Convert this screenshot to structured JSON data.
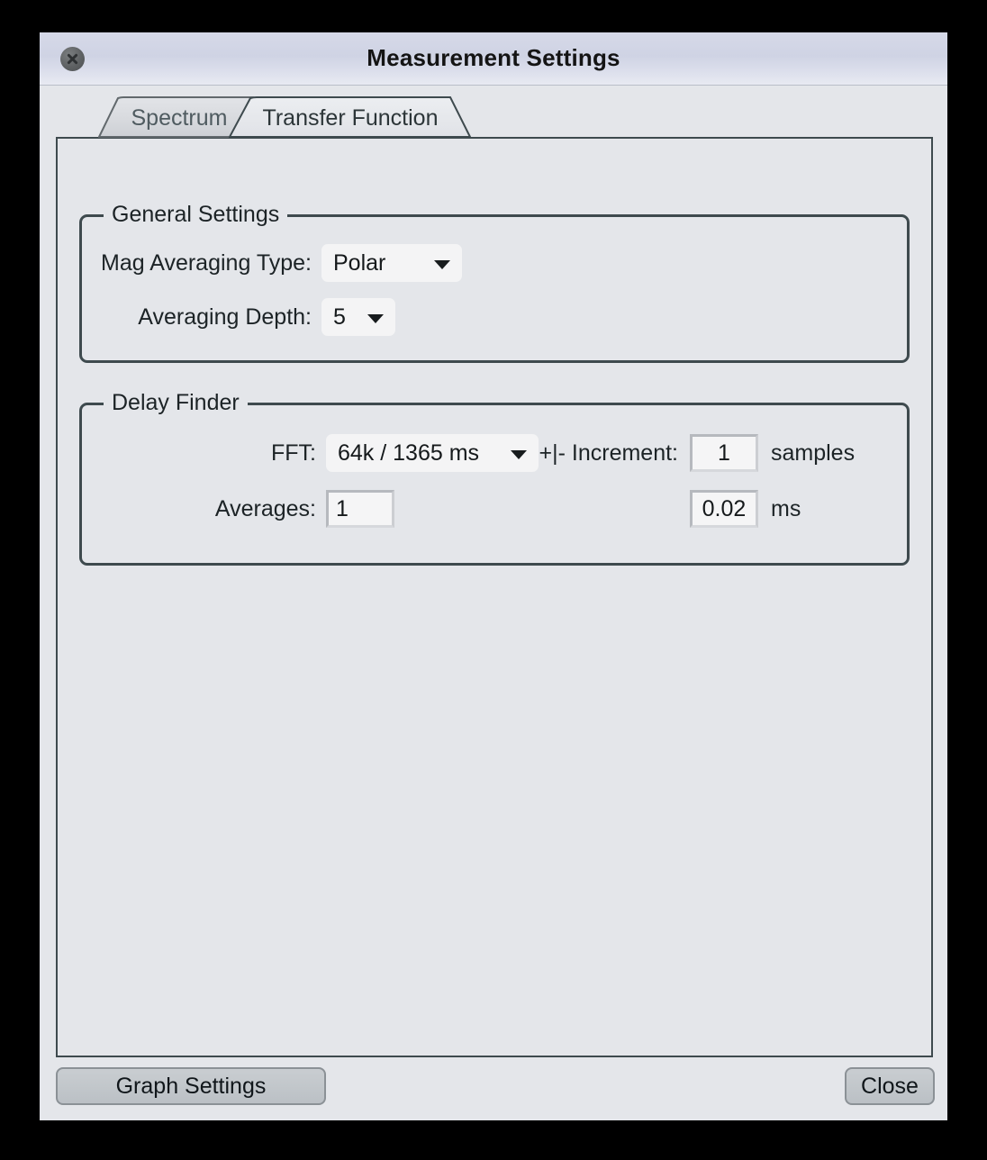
{
  "window": {
    "title": "Measurement Settings",
    "close_icon": "close-circle-icon"
  },
  "tabs": [
    {
      "label": "Spectrum",
      "active": false
    },
    {
      "label": "Transfer Function",
      "active": true
    }
  ],
  "general_settings": {
    "title": "General Settings",
    "mag_averaging_type": {
      "label": "Mag Averaging Type:",
      "value": "Polar",
      "arrow_icon": "chevron-down-icon"
    },
    "averaging_depth": {
      "label": "Averaging Depth:",
      "value": "5",
      "arrow_icon": "chevron-down-icon"
    }
  },
  "delay_finder": {
    "title": "Delay Finder",
    "fft": {
      "label": "FFT:",
      "value": "64k / 1365 ms",
      "arrow_icon": "chevron-down-icon"
    },
    "averages": {
      "label": "Averages:",
      "value": "1"
    },
    "increment": {
      "label": "+|- Increment:",
      "value": "1",
      "unit": "samples"
    },
    "increment_ms": {
      "value": "0.02",
      "unit": "ms"
    }
  },
  "footer": {
    "graph_settings_label": "Graph Settings",
    "close_label": "Close"
  },
  "colors": {
    "window_bg": "#e4e6ea",
    "titlebar_top": "#d6d9e8",
    "panel_border": "#3e4a4e",
    "field_bg": "#f4f4f5",
    "button_bg": "#c3c8cc",
    "text": "#1c2326"
  }
}
